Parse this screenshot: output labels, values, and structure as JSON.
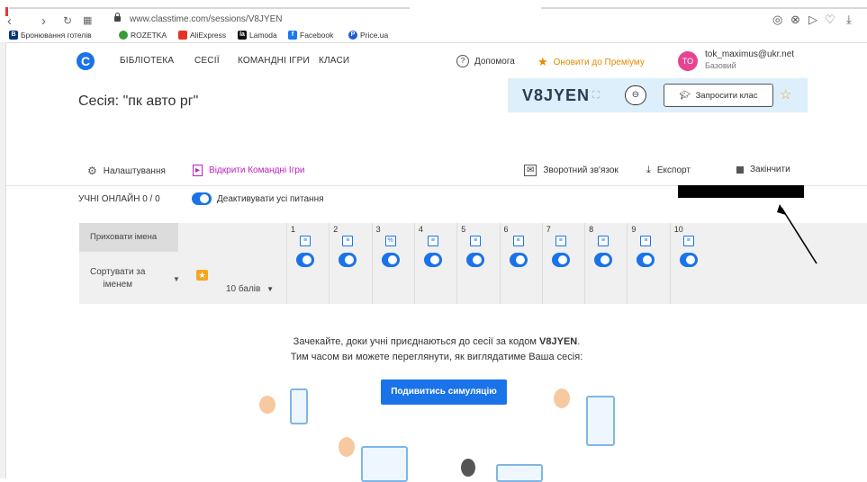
{
  "browser": {
    "url": "www.classtime.com/sessions/V8JYEN",
    "bookmarks": [
      "Бронювання готелів",
      "ROZETKA",
      "AliExpress",
      "Lamoda",
      "Facebook",
      "Price.ua"
    ]
  },
  "topnav": {
    "items": [
      "БІБЛІОТЕКА",
      "СЕСІЇ",
      "КОМАНДНІ ІГРИ",
      "КЛАСИ"
    ],
    "help": "Допомога",
    "upgrade": "Оновити до Преміуму",
    "avatar_initials": "TO",
    "user_email": "tok_maximus@ukr.net",
    "user_plan": "Базовий"
  },
  "session": {
    "title": "Сесія: \"пк авто рг\"",
    "code": "V8JYEN",
    "invite_label": "Запросити клас"
  },
  "subbar": {
    "settings": "Налаштування",
    "open_team_games": "Відкрити Командні Ігри",
    "feedback": "Зворотний зв'язок",
    "export": "Експорт",
    "finish": "Закінчити"
  },
  "online": {
    "label": "УЧНІ ОНЛАЙН 0 / 0",
    "deactivate": "Деактивувати усі питання"
  },
  "grid": {
    "hide_names": "Приховати імена",
    "sort_line1": "Сортувати за",
    "sort_line2": "іменем",
    "points": "10 балів",
    "questions": [
      "1",
      "2",
      "3",
      "4",
      "5",
      "6",
      "7",
      "8",
      "9",
      "10"
    ]
  },
  "waiting": {
    "line1_prefix": "Зачекайте, доки учні приєднаються до сесії за кодом ",
    "line1_code": "V8JYEN",
    "line1_suffix": ".",
    "line2": "Тим часом ви можете переглянути, як виглядатиме Ваша сесія:",
    "simulate_button": "Подивитись симуляцію"
  }
}
